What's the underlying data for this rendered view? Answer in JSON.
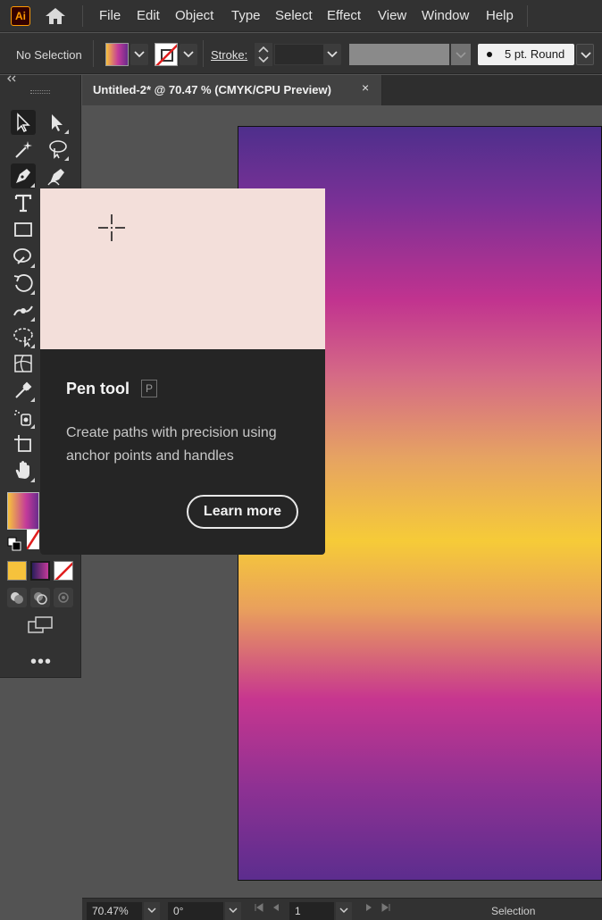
{
  "app": {
    "logo_text": "Ai",
    "brand_color": "#ff9a00"
  },
  "menu": {
    "items": [
      "File",
      "Edit",
      "Object",
      "Type",
      "Select",
      "Effect",
      "View",
      "Window",
      "Help"
    ]
  },
  "control_bar": {
    "selection_status": "No Selection",
    "stroke_label": "Stroke:",
    "stroke_weight": "",
    "brush_definition": "5 pt. Round"
  },
  "document": {
    "tab_title": "Untitled-2* @ 70.47 % (CMYK/CPU Preview)",
    "close_icon": "×"
  },
  "tooltip": {
    "title": "Pen tool",
    "shortcut": "P",
    "description": "Create paths with precision using anchor points and handles",
    "learn_more_label": "Learn more"
  },
  "artboard": {
    "gradient_colors": [
      "#4e2f8c",
      "#c1338f",
      "#f6cb38",
      "#c7368f",
      "#5c2d8e"
    ]
  },
  "status_bar": {
    "zoom": "70.47%",
    "rotation": "0°",
    "artboard_number": "1",
    "current_tool": "Selection"
  },
  "toolbar": {
    "tools": [
      "selection-tool",
      "direct-selection-tool",
      "magic-wand-tool",
      "lasso-tool",
      "pen-tool",
      "curvature-tool",
      "type-tool",
      "rectangle-tool",
      "shaper-tool",
      "rotate-tool",
      "width-tool",
      "free-transform-tool",
      "mesh-tool",
      "eyedropper-tool",
      "symbol-sprayer-tool",
      "artboard-tool",
      "hand-tool"
    ],
    "more_label": "•••"
  }
}
